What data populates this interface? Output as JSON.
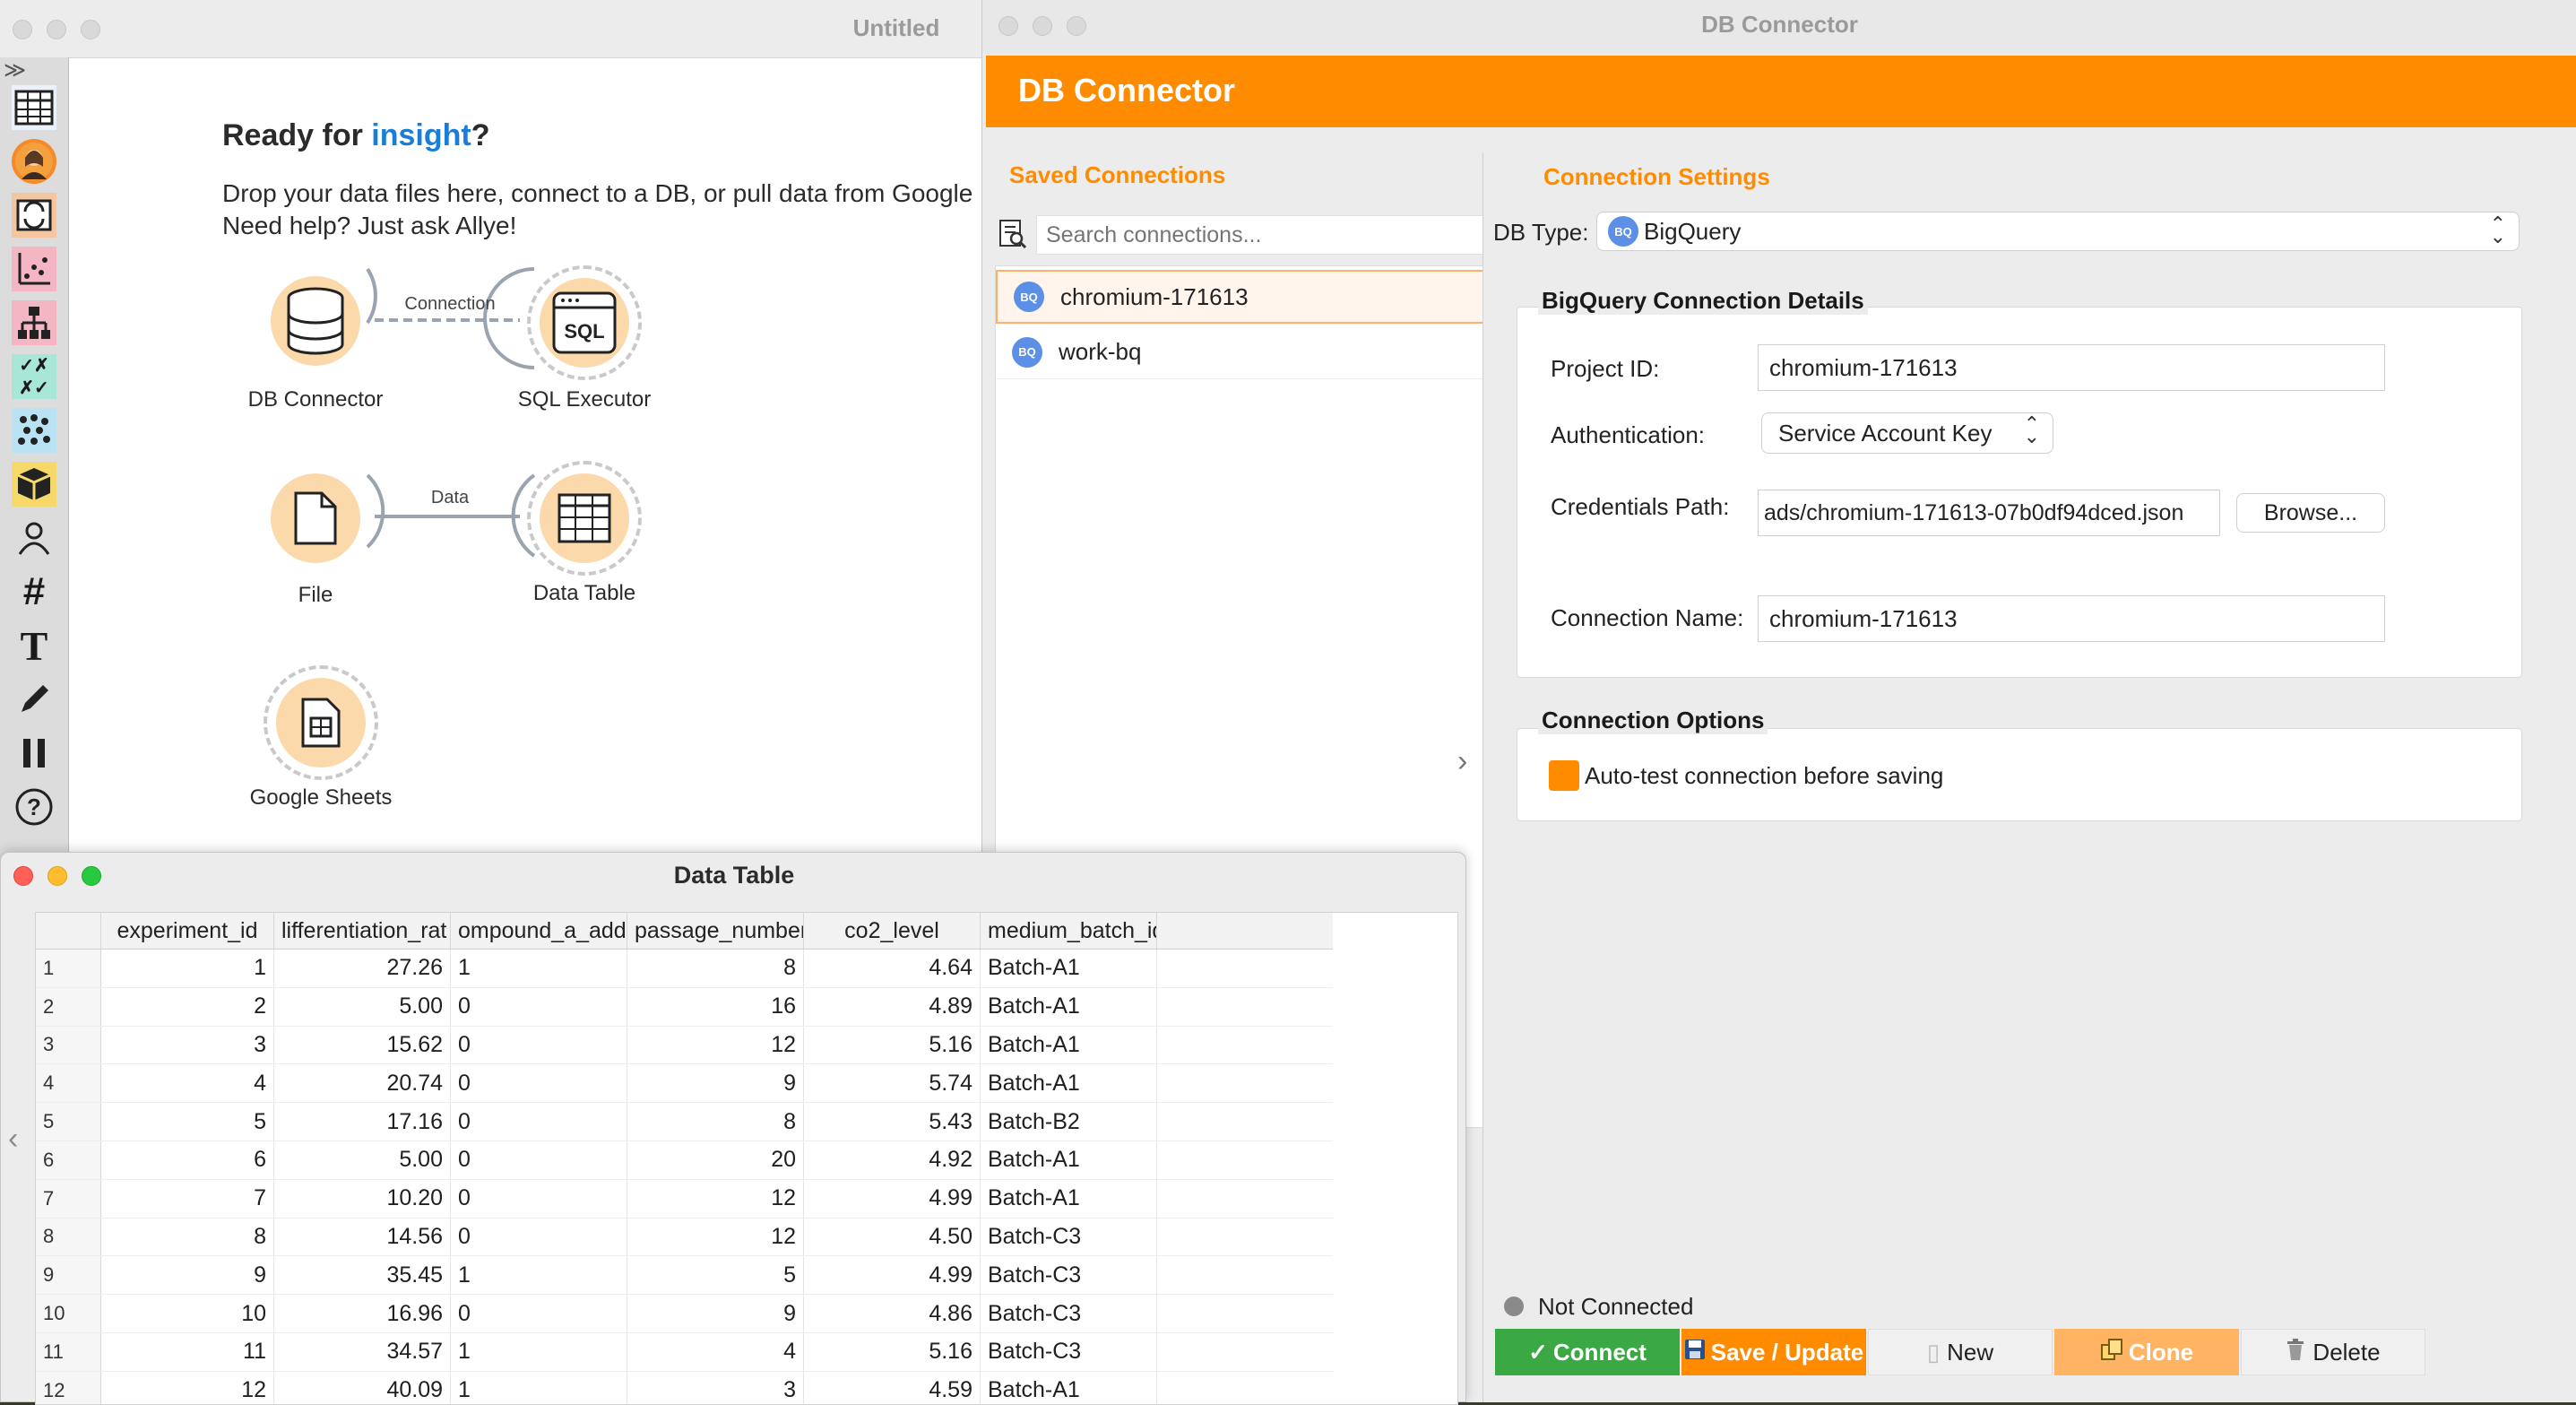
{
  "canvas": {
    "window_title": "Untitled",
    "welcome_prefix": "Ready for ",
    "welcome_highlight": "insight",
    "welcome_suffix": "?",
    "welcome_line1": "Drop your data files here, connect to a DB, or pull data from Google",
    "welcome_line2": "Need help? Just ask Allye!",
    "nodes": {
      "db_connector": "DB Connector",
      "sql_executor": "SQL Executor",
      "file": "File",
      "data_table": "Data Table",
      "google_sheets": "Google Sheets",
      "sql_icon_text": "SQL"
    },
    "links": {
      "connection": "Connection",
      "data": "Data"
    },
    "toolbox_expand": "≫",
    "toolbox_icons": [
      "table-icon",
      "assistant-avatar-icon",
      "transform-icon",
      "scatter-plot-icon",
      "hierarchy-icon",
      "matrix-icon",
      "cluster-icon",
      "cube-icon",
      "person-icon",
      "hash-icon",
      "text-icon",
      "pencil-icon",
      "pause-icon",
      "help-icon"
    ]
  },
  "db_connector": {
    "window_title": "DB Connector",
    "header_title": "DB Connector",
    "saved_connections_title": "Saved Connections",
    "search_placeholder": "Search connections...",
    "connections": [
      {
        "badge": "BQ",
        "name": "chromium-171613",
        "selected": true
      },
      {
        "badge": "BQ",
        "name": "work-bq",
        "selected": false
      }
    ],
    "settings_title": "Connection Settings",
    "db_type_label": "DB Type:",
    "db_type_badge": "BQ",
    "db_type_value": "BigQuery",
    "details_title": "BigQuery Connection Details",
    "project_id_label": "Project ID:",
    "project_id_value": "chromium-171613",
    "auth_label": "Authentication:",
    "auth_value": "Service Account Key",
    "credentials_label": "Credentials Path:",
    "credentials_value": "ads/chromium-171613-07b0df94dced.json",
    "browse_label": "Browse...",
    "connection_name_label": "Connection Name:",
    "connection_name_value": "chromium-171613",
    "options_title": "Connection Options",
    "autotest_label": "Auto-test connection before saving",
    "status_text": "Not Connected",
    "buttons": {
      "connect": "Connect",
      "save_update": "Save / Update",
      "new": "New",
      "clone": "Clone",
      "delete": "Delete"
    },
    "colors": {
      "accent": "#ff8c00",
      "connect_green": "#3aa843",
      "clone_orange": "#ffb463"
    }
  },
  "data_table": {
    "window_title": "Data Table",
    "columns": [
      "experiment_id",
      "lifferentiation_rat",
      "ompound_a_adde",
      "passage_number",
      "co2_level",
      "medium_batch_id"
    ],
    "rows": [
      [
        "1",
        "1",
        "27.26",
        "1",
        "8",
        "4.64",
        "Batch-A1"
      ],
      [
        "2",
        "2",
        "5.00",
        "0",
        "16",
        "4.89",
        "Batch-A1"
      ],
      [
        "3",
        "3",
        "15.62",
        "0",
        "12",
        "5.16",
        "Batch-A1"
      ],
      [
        "4",
        "4",
        "20.74",
        "0",
        "9",
        "5.74",
        "Batch-A1"
      ],
      [
        "5",
        "5",
        "17.16",
        "0",
        "8",
        "5.43",
        "Batch-B2"
      ],
      [
        "6",
        "6",
        "5.00",
        "0",
        "20",
        "4.92",
        "Batch-A1"
      ],
      [
        "7",
        "7",
        "10.20",
        "0",
        "12",
        "4.99",
        "Batch-A1"
      ],
      [
        "8",
        "8",
        "14.56",
        "0",
        "12",
        "4.50",
        "Batch-C3"
      ],
      [
        "9",
        "9",
        "35.45",
        "1",
        "5",
        "4.99",
        "Batch-C3"
      ],
      [
        "10",
        "10",
        "16.96",
        "0",
        "9",
        "4.86",
        "Batch-C3"
      ],
      [
        "11",
        "11",
        "34.57",
        "1",
        "4",
        "5.16",
        "Batch-C3"
      ],
      [
        "12",
        "12",
        "40.09",
        "1",
        "3",
        "4.59",
        "Batch-A1"
      ]
    ]
  }
}
